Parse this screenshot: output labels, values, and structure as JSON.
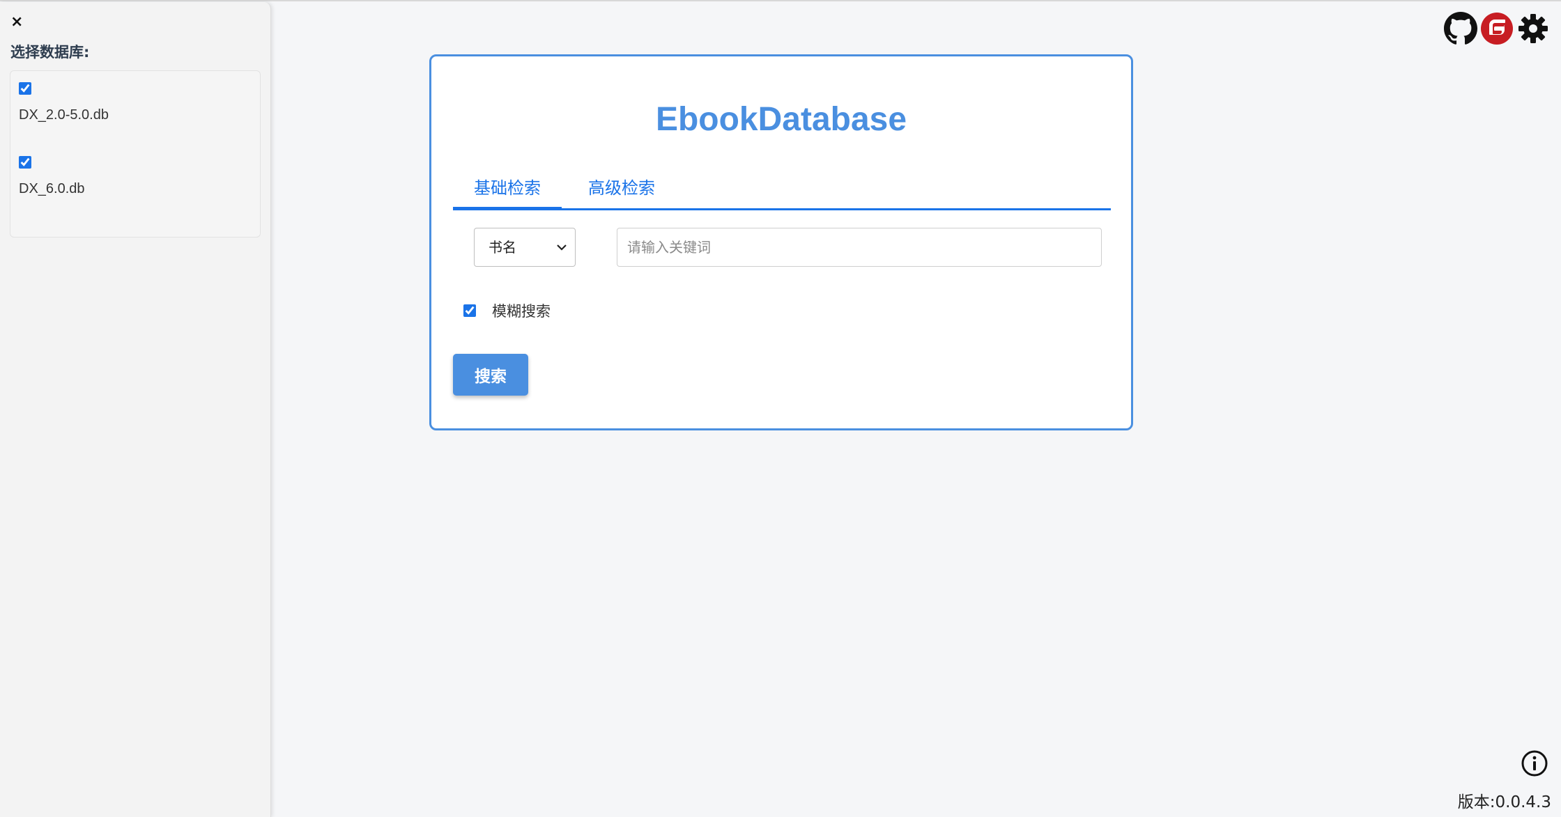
{
  "sidebar": {
    "close_label": "×",
    "heading": "选择数据库:",
    "databases": [
      {
        "name": "DX_2.0-5.0.db",
        "checked": true
      },
      {
        "name": "DX_6.0.db",
        "checked": true
      }
    ]
  },
  "header_icons": [
    "github-icon",
    "gitee-icon",
    "gear-icon"
  ],
  "main": {
    "title": "EbookDatabase",
    "tabs": [
      {
        "label": "基础检索",
        "active": true
      },
      {
        "label": "高级检索",
        "active": false
      }
    ],
    "field_select": {
      "value": "书名"
    },
    "keyword_input": {
      "placeholder": "请输入关键词",
      "value": ""
    },
    "fuzzy": {
      "label": "模糊搜索",
      "checked": true
    },
    "search_button": "搜索"
  },
  "footer": {
    "version": "版本:0.0.4.3"
  },
  "colors": {
    "accent": "#4a8fe0",
    "tab_blue": "#1a73e8",
    "gitee_red": "#c71d23",
    "background": "#f5f6f8"
  }
}
